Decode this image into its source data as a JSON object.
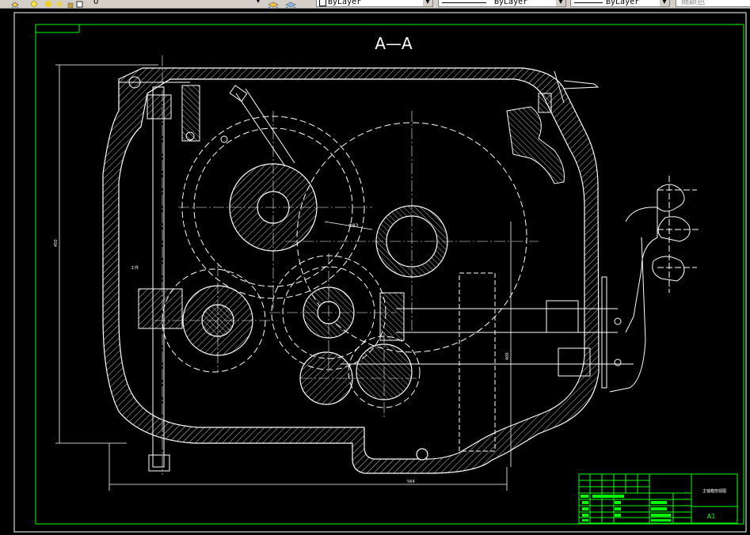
{
  "toolbar": {
    "layer_current": "0",
    "color": "ByLayer",
    "linetype": "ByLayer",
    "lineweight": "ByLayer",
    "plot_style": "随颜色"
  },
  "drawing": {
    "section_title": "A—A",
    "dimension_bottom": "564",
    "dimension_left": "450",
    "dimension_mid": "400",
    "dimension_gear": "Φ83",
    "note_left": "工件",
    "title_block_name": "主轴箱剖视图",
    "sheet_size": "A1"
  },
  "colors": {
    "background": "#000000",
    "frame": "#00ff00",
    "lines": "#ffffff",
    "toolbar": "#d4d0c8"
  }
}
